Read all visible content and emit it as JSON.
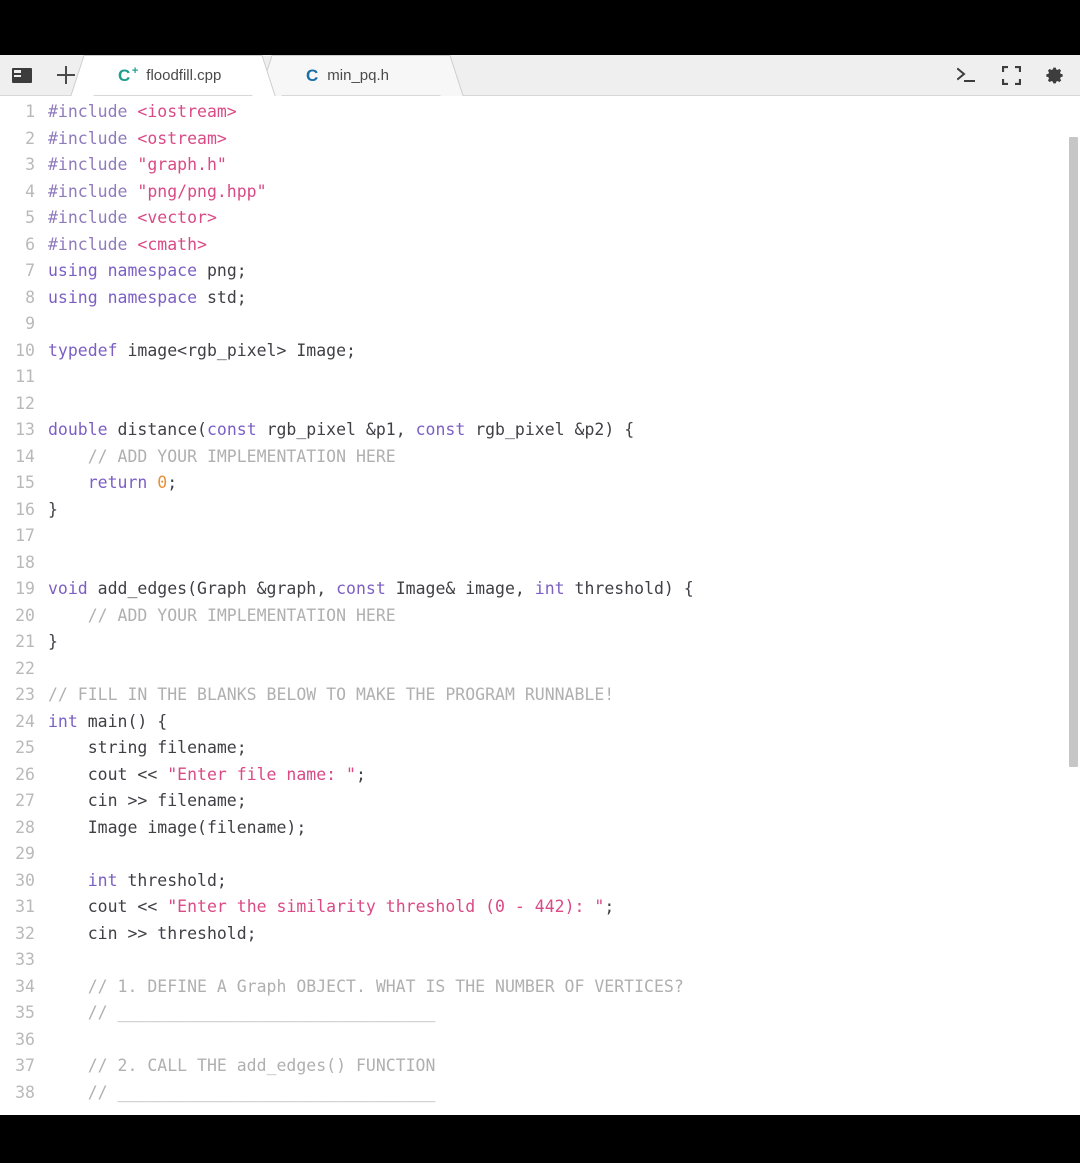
{
  "window": {
    "title_bar_icons": {
      "panel": "panel-icon",
      "new_tab": "plus-icon"
    },
    "toolbar": [
      {
        "name": "terminal-icon",
        "label": ">_"
      },
      {
        "name": "fullscreen-icon",
        "label": "[ ]"
      },
      {
        "name": "gear-icon",
        "label": "gear"
      }
    ]
  },
  "tabs": [
    {
      "label": "floodfill.cpp",
      "icon": "cpp-file-icon",
      "icon_glyph": "C",
      "active": true
    },
    {
      "label": "min_pq.h",
      "icon": "c-header-file-icon",
      "icon_glyph": "C",
      "active": false
    }
  ],
  "colors": {
    "keyword": "#7c5fc4",
    "preprocessor": "#8f7bbd",
    "string": "#d94a86",
    "comment": "#b0b0b0",
    "number": "#e8913a",
    "plain": "#3f3f46",
    "line_number": "#b9b9b9",
    "editor_bg": "#ffffff",
    "tabbar_bg": "#efefef",
    "letterbox": "#000000"
  },
  "editor": {
    "language": "cpp",
    "first_visible_line": 1,
    "last_visible_line": 38,
    "scroll_position": "top",
    "lines": [
      {
        "n": 1,
        "tokens": [
          {
            "t": "#include ",
            "c": "pp"
          },
          {
            "t": "<iostream>",
            "c": "str"
          }
        ]
      },
      {
        "n": 2,
        "tokens": [
          {
            "t": "#include ",
            "c": "pp"
          },
          {
            "t": "<ostream>",
            "c": "str"
          }
        ]
      },
      {
        "n": 3,
        "tokens": [
          {
            "t": "#include ",
            "c": "pp"
          },
          {
            "t": "\"graph.h\"",
            "c": "str"
          }
        ]
      },
      {
        "n": 4,
        "tokens": [
          {
            "t": "#include ",
            "c": "pp"
          },
          {
            "t": "\"png/png.hpp\"",
            "c": "str"
          }
        ]
      },
      {
        "n": 5,
        "tokens": [
          {
            "t": "#include ",
            "c": "pp"
          },
          {
            "t": "<vector>",
            "c": "str"
          }
        ]
      },
      {
        "n": 6,
        "tokens": [
          {
            "t": "#include ",
            "c": "pp"
          },
          {
            "t": "<cmath>",
            "c": "str"
          }
        ]
      },
      {
        "n": 7,
        "tokens": [
          {
            "t": "using namespace ",
            "c": "kw"
          },
          {
            "t": "png;",
            "c": "pl"
          }
        ]
      },
      {
        "n": 8,
        "tokens": [
          {
            "t": "using namespace ",
            "c": "kw"
          },
          {
            "t": "std;",
            "c": "pl"
          }
        ]
      },
      {
        "n": 9,
        "tokens": []
      },
      {
        "n": 10,
        "tokens": [
          {
            "t": "typedef ",
            "c": "kw"
          },
          {
            "t": "image<rgb_pixel> Image;",
            "c": "pl"
          }
        ]
      },
      {
        "n": 11,
        "tokens": []
      },
      {
        "n": 12,
        "tokens": []
      },
      {
        "n": 13,
        "tokens": [
          {
            "t": "double ",
            "c": "kw"
          },
          {
            "t": "distance(",
            "c": "pl"
          },
          {
            "t": "const ",
            "c": "kw"
          },
          {
            "t": "rgb_pixel &p1, ",
            "c": "pl"
          },
          {
            "t": "const ",
            "c": "kw"
          },
          {
            "t": "rgb_pixel &p2) {",
            "c": "pl"
          }
        ]
      },
      {
        "n": 14,
        "tokens": [
          {
            "t": "    // ADD YOUR IMPLEMENTATION HERE",
            "c": "cm"
          }
        ]
      },
      {
        "n": 15,
        "tokens": [
          {
            "t": "    ",
            "c": "pl"
          },
          {
            "t": "return ",
            "c": "kw"
          },
          {
            "t": "0",
            "c": "num"
          },
          {
            "t": ";",
            "c": "pl"
          }
        ]
      },
      {
        "n": 16,
        "tokens": [
          {
            "t": "}",
            "c": "pl"
          }
        ]
      },
      {
        "n": 17,
        "tokens": []
      },
      {
        "n": 18,
        "tokens": []
      },
      {
        "n": 19,
        "tokens": [
          {
            "t": "void ",
            "c": "kw"
          },
          {
            "t": "add_edges(Graph &graph, ",
            "c": "pl"
          },
          {
            "t": "const ",
            "c": "kw"
          },
          {
            "t": "Image& image, ",
            "c": "pl"
          },
          {
            "t": "int ",
            "c": "kw"
          },
          {
            "t": "threshold) {",
            "c": "pl"
          }
        ]
      },
      {
        "n": 20,
        "tokens": [
          {
            "t": "    // ADD YOUR IMPLEMENTATION HERE",
            "c": "cm"
          }
        ]
      },
      {
        "n": 21,
        "tokens": [
          {
            "t": "}",
            "c": "pl"
          }
        ]
      },
      {
        "n": 22,
        "tokens": []
      },
      {
        "n": 23,
        "tokens": [
          {
            "t": "// FILL IN THE BLANKS BELOW TO MAKE THE PROGRAM RUNNABLE!",
            "c": "cm"
          }
        ]
      },
      {
        "n": 24,
        "tokens": [
          {
            "t": "int ",
            "c": "kw"
          },
          {
            "t": "main() {",
            "c": "pl"
          }
        ]
      },
      {
        "n": 25,
        "tokens": [
          {
            "t": "    string filename;",
            "c": "pl"
          }
        ]
      },
      {
        "n": 26,
        "tokens": [
          {
            "t": "    cout << ",
            "c": "pl"
          },
          {
            "t": "\"Enter file name: \"",
            "c": "str"
          },
          {
            "t": ";",
            "c": "pl"
          }
        ]
      },
      {
        "n": 27,
        "tokens": [
          {
            "t": "    cin >> filename;",
            "c": "pl"
          }
        ]
      },
      {
        "n": 28,
        "tokens": [
          {
            "t": "    Image image(filename);",
            "c": "pl"
          }
        ]
      },
      {
        "n": 29,
        "tokens": []
      },
      {
        "n": 30,
        "tokens": [
          {
            "t": "    ",
            "c": "pl"
          },
          {
            "t": "int ",
            "c": "kw"
          },
          {
            "t": "threshold;",
            "c": "pl"
          }
        ]
      },
      {
        "n": 31,
        "tokens": [
          {
            "t": "    cout << ",
            "c": "pl"
          },
          {
            "t": "\"Enter the similarity threshold (0 - 442): \"",
            "c": "str"
          },
          {
            "t": ";",
            "c": "pl"
          }
        ]
      },
      {
        "n": 32,
        "tokens": [
          {
            "t": "    cin >> threshold;",
            "c": "pl"
          }
        ]
      },
      {
        "n": 33,
        "tokens": []
      },
      {
        "n": 34,
        "tokens": [
          {
            "t": "    // 1. DEFINE A Graph OBJECT. WHAT IS THE NUMBER OF VERTICES?",
            "c": "cm"
          }
        ]
      },
      {
        "n": 35,
        "tokens": [
          {
            "t": "    // ________________________________",
            "c": "cm"
          }
        ]
      },
      {
        "n": 36,
        "tokens": []
      },
      {
        "n": 37,
        "tokens": [
          {
            "t": "    // 2. CALL THE add_edges() FUNCTION",
            "c": "cm"
          }
        ]
      },
      {
        "n": 38,
        "tokens": [
          {
            "t": "    // ________________________________",
            "c": "cm"
          }
        ]
      }
    ]
  }
}
